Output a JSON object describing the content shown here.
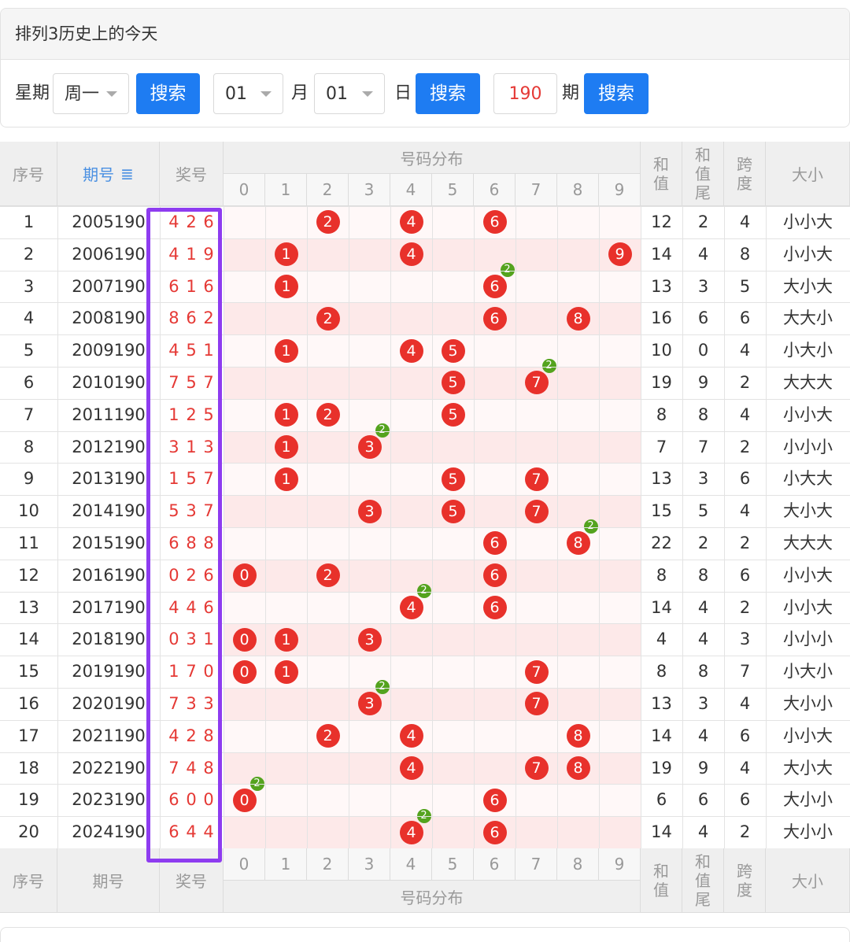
{
  "header": {
    "title": "排列3历史上的今天"
  },
  "filter": {
    "weekday_label": "星期",
    "weekday_value": "周一",
    "search1": "搜索",
    "month_value": "01",
    "month_label": "月",
    "day_value": "01",
    "day_label": "日",
    "search2": "搜索",
    "period_value": "190",
    "period_label": "期",
    "search3": "搜索"
  },
  "table": {
    "headers": {
      "seq": "序号",
      "issue": "期号",
      "sort_icon": "sort-icon",
      "prize": "奖号",
      "dist": "号码分布",
      "sum": [
        "和",
        "值"
      ],
      "sumtail": [
        "和",
        "值",
        "尾"
      ],
      "span": [
        "跨",
        "度"
      ],
      "size": "大小"
    },
    "digits": [
      "0",
      "1",
      "2",
      "3",
      "4",
      "5",
      "6",
      "7",
      "8",
      "9"
    ],
    "rows": [
      {
        "seq": "1",
        "issue": "2005190",
        "prize": "4 2 6",
        "balls": [
          2,
          4,
          6
        ],
        "dup": null,
        "sum": "12",
        "tail": "2",
        "span": "4",
        "size": "小小大"
      },
      {
        "seq": "2",
        "issue": "2006190",
        "prize": "4 1 9",
        "balls": [
          1,
          4,
          9
        ],
        "dup": null,
        "sum": "14",
        "tail": "4",
        "span": "8",
        "size": "小小大"
      },
      {
        "seq": "3",
        "issue": "2007190",
        "prize": "6 1 6",
        "balls": [
          1,
          6
        ],
        "dup": 6,
        "sum": "13",
        "tail": "3",
        "span": "5",
        "size": "大小大"
      },
      {
        "seq": "4",
        "issue": "2008190",
        "prize": "8 6 2",
        "balls": [
          2,
          6,
          8
        ],
        "dup": null,
        "sum": "16",
        "tail": "6",
        "span": "6",
        "size": "大大小"
      },
      {
        "seq": "5",
        "issue": "2009190",
        "prize": "4 5 1",
        "balls": [
          1,
          4,
          5
        ],
        "dup": null,
        "sum": "10",
        "tail": "0",
        "span": "4",
        "size": "小大小"
      },
      {
        "seq": "6",
        "issue": "2010190",
        "prize": "7 5 7",
        "balls": [
          5,
          7
        ],
        "dup": 7,
        "sum": "19",
        "tail": "9",
        "span": "2",
        "size": "大大大"
      },
      {
        "seq": "7",
        "issue": "2011190",
        "prize": "1 2 5",
        "balls": [
          1,
          2,
          5
        ],
        "dup": null,
        "sum": "8",
        "tail": "8",
        "span": "4",
        "size": "小小大"
      },
      {
        "seq": "8",
        "issue": "2012190",
        "prize": "3 1 3",
        "balls": [
          1,
          3
        ],
        "dup": 3,
        "sum": "7",
        "tail": "7",
        "span": "2",
        "size": "小小小"
      },
      {
        "seq": "9",
        "issue": "2013190",
        "prize": "1 5 7",
        "balls": [
          1,
          5,
          7
        ],
        "dup": null,
        "sum": "13",
        "tail": "3",
        "span": "6",
        "size": "小大大"
      },
      {
        "seq": "10",
        "issue": "2014190",
        "prize": "5 3 7",
        "balls": [
          3,
          5,
          7
        ],
        "dup": null,
        "sum": "15",
        "tail": "5",
        "span": "4",
        "size": "大小大"
      },
      {
        "seq": "11",
        "issue": "2015190",
        "prize": "6 8 8",
        "balls": [
          6,
          8
        ],
        "dup": 8,
        "sum": "22",
        "tail": "2",
        "span": "2",
        "size": "大大大"
      },
      {
        "seq": "12",
        "issue": "2016190",
        "prize": "0 2 6",
        "balls": [
          0,
          2,
          6
        ],
        "dup": null,
        "sum": "8",
        "tail": "8",
        "span": "6",
        "size": "小小大"
      },
      {
        "seq": "13",
        "issue": "2017190",
        "prize": "4 4 6",
        "balls": [
          4,
          6
        ],
        "dup": 4,
        "sum": "14",
        "tail": "4",
        "span": "2",
        "size": "小小大"
      },
      {
        "seq": "14",
        "issue": "2018190",
        "prize": "0 3 1",
        "balls": [
          0,
          1,
          3
        ],
        "dup": null,
        "sum": "4",
        "tail": "4",
        "span": "3",
        "size": "小小小"
      },
      {
        "seq": "15",
        "issue": "2019190",
        "prize": "1 7 0",
        "balls": [
          0,
          1,
          7
        ],
        "dup": null,
        "sum": "8",
        "tail": "8",
        "span": "7",
        "size": "小大小"
      },
      {
        "seq": "16",
        "issue": "2020190",
        "prize": "7 3 3",
        "balls": [
          3,
          7
        ],
        "dup": 3,
        "sum": "13",
        "tail": "3",
        "span": "4",
        "size": "大小小"
      },
      {
        "seq": "17",
        "issue": "2021190",
        "prize": "4 2 8",
        "balls": [
          2,
          4,
          8
        ],
        "dup": null,
        "sum": "14",
        "tail": "4",
        "span": "6",
        "size": "小小大"
      },
      {
        "seq": "18",
        "issue": "2022190",
        "prize": "7 4 8",
        "balls": [
          4,
          7,
          8
        ],
        "dup": null,
        "sum": "19",
        "tail": "9",
        "span": "4",
        "size": "大小大"
      },
      {
        "seq": "19",
        "issue": "2023190",
        "prize": "6 0 0",
        "balls": [
          0,
          6
        ],
        "dup": 0,
        "sum": "6",
        "tail": "6",
        "span": "6",
        "size": "大小小"
      },
      {
        "seq": "20",
        "issue": "2024190",
        "prize": "6 4 4",
        "balls": [
          4,
          6
        ],
        "dup": 4,
        "sum": "14",
        "tail": "4",
        "span": "2",
        "size": "大小小"
      }
    ],
    "dup_badge": "2"
  },
  "colors": {
    "ball": "#e8312b",
    "badge": "#54a31e",
    "button": "#1e7cf2",
    "highlight": "#8e3cf0",
    "prize_text": "#e53935",
    "issue_header": "#4a90e2"
  }
}
